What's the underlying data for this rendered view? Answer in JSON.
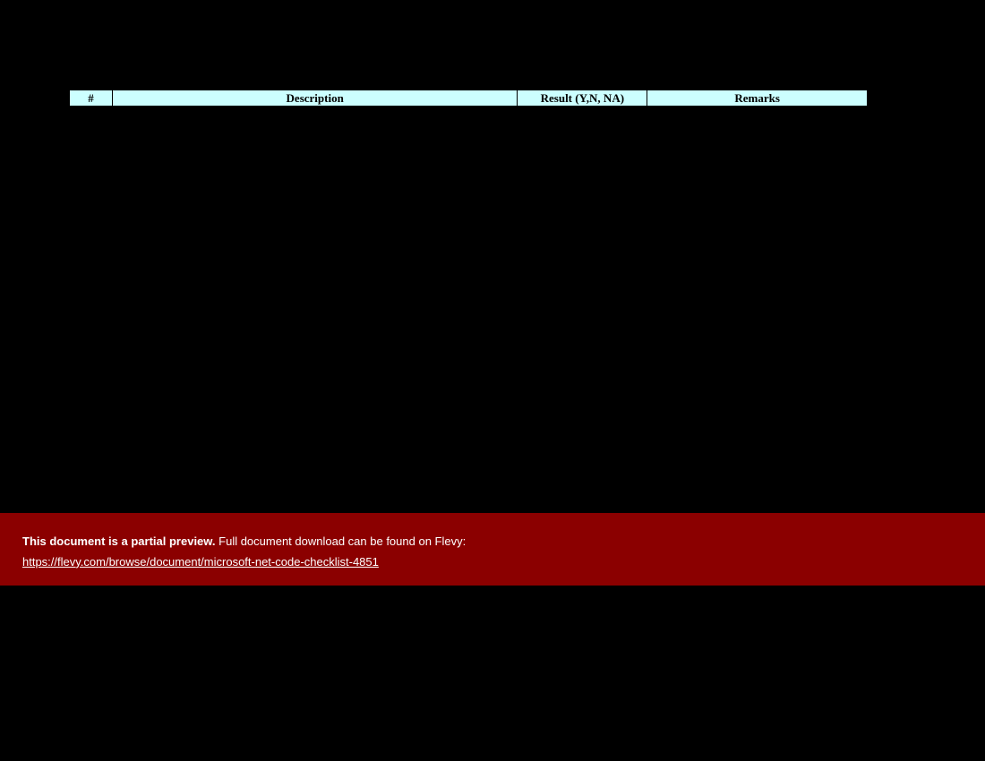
{
  "table": {
    "headers": {
      "num": "#",
      "description": "Description",
      "result": "Result (Y,N, NA)",
      "remarks": "Remarks"
    }
  },
  "banner": {
    "bold_text": "This document is a partial preview.",
    "rest_text": "  Full document download can be found on Flevy:",
    "link_text": "https://flevy.com/browse/document/microsoft-net-code-checklist-4851"
  }
}
